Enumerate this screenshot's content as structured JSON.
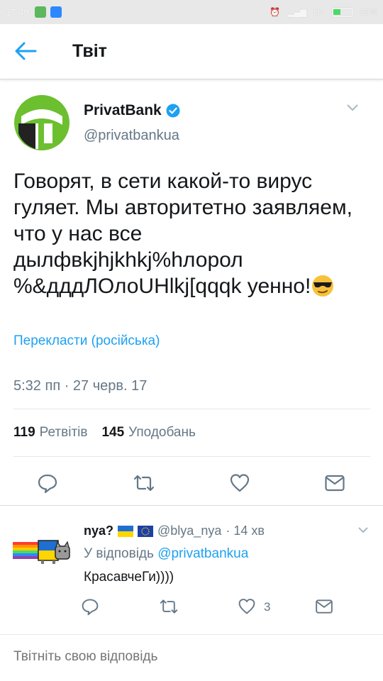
{
  "status_bar": {
    "time": "17:49",
    "network": "H+",
    "battery": "39%",
    "battery_level": 0.39
  },
  "header": {
    "title": "Твіт",
    "back_icon": "back-arrow-icon"
  },
  "tweet": {
    "author_name": "PrivatBank",
    "verified": true,
    "handle": "@privatbankua",
    "text": "Говорят, в сети какой-то вирус гуляет. Мы авторитетно заявляем, что у нас все дылфвkjhjkhkj%hлорол %&дддЛОлоUHlkj[qqqk уенно!",
    "emoji": "cool-sunglasses-emoji",
    "translate_link": "Перекласти (російська)",
    "timestamp": "5:32 пп · 27 черв. 17",
    "retweets_count": "119",
    "retweets_label": "Ретвітів",
    "likes_count": "145",
    "likes_label": "Уподобань"
  },
  "reply": {
    "author_name": "nya?",
    "handle": "@blya_nya",
    "time": "· 14 хв",
    "reply_to_prefix": "У відповідь",
    "reply_to_handle": "@privatbankua",
    "text": "КрасавчеГи))))",
    "likes_count": "3"
  },
  "compose": {
    "placeholder": "Твітніть свою відповідь"
  },
  "colors": {
    "accent": "#1da1f2",
    "secondary_text": "#657786",
    "brand_green": "#6cbf2f"
  }
}
